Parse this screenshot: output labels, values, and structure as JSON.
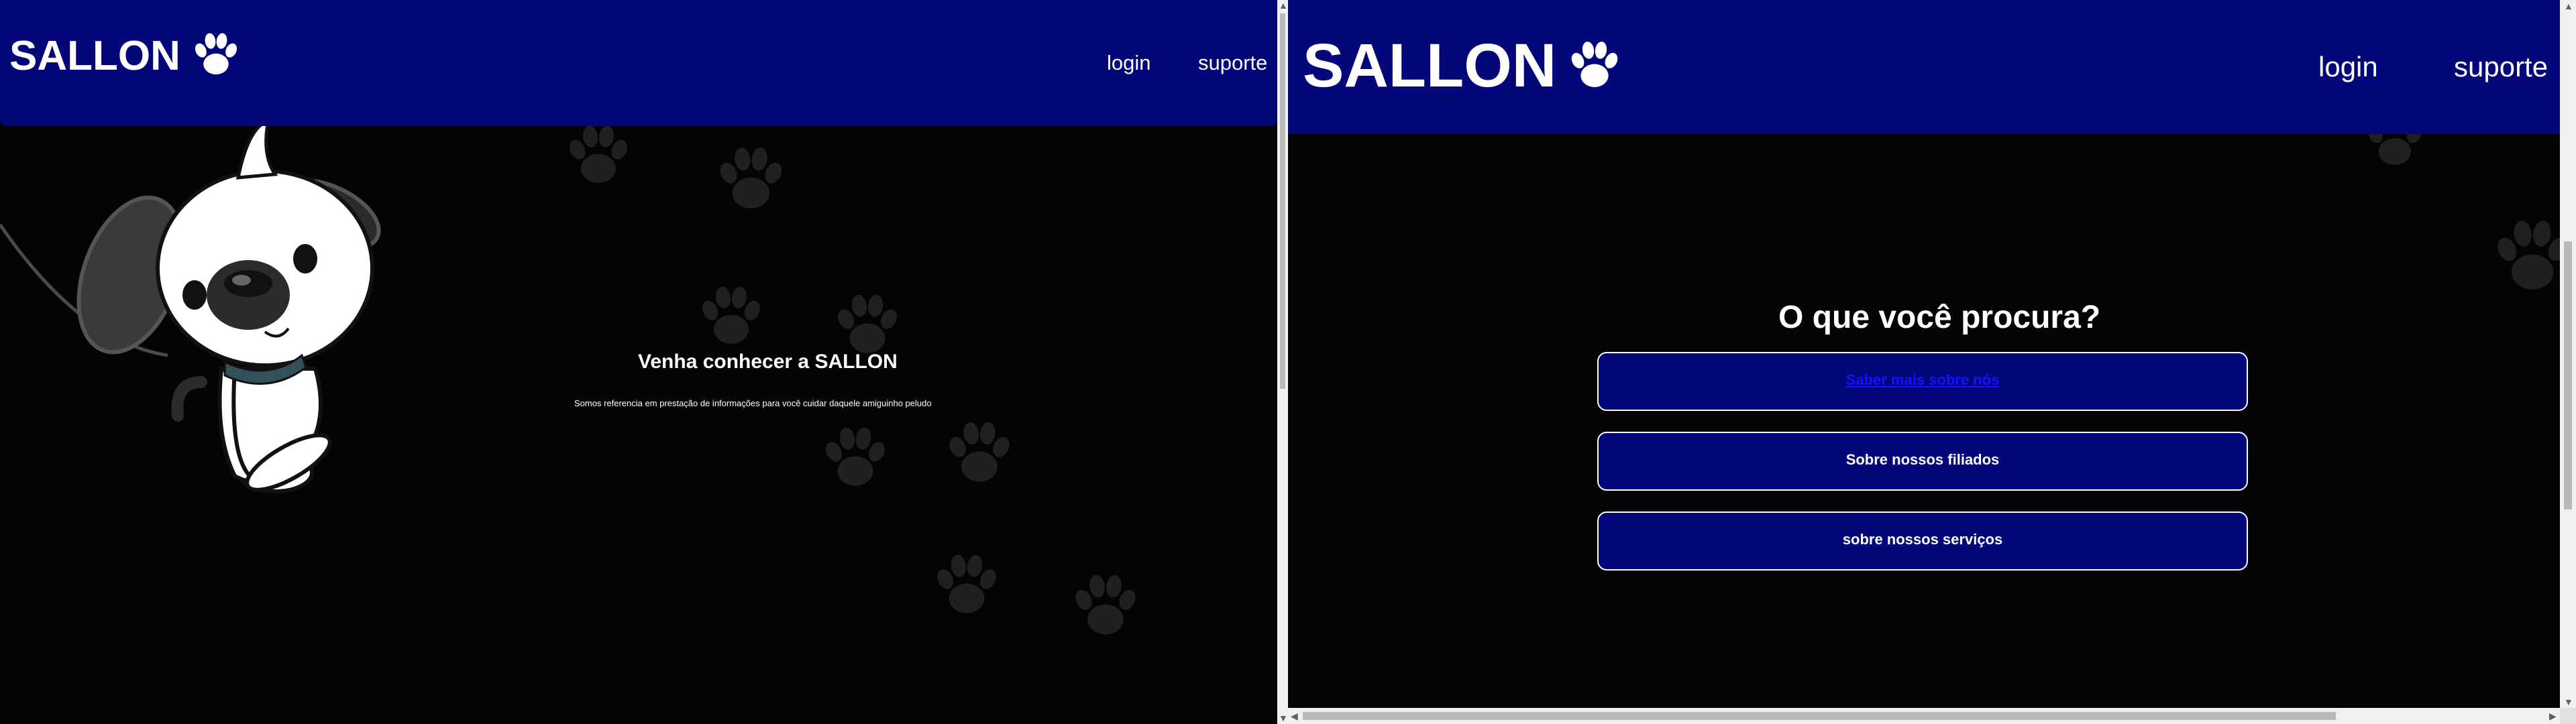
{
  "brand": "SALLON",
  "nav": {
    "login": "login",
    "support": "suporte"
  },
  "left": {
    "hero_title": "Venha conhecer a SALLON",
    "hero_subtitle": "Somos referencia em prestação de informações para você cuidar daquele amiguinho peludo"
  },
  "right": {
    "question": "O que você procura?",
    "options": [
      {
        "label": "Saber mais sobre nós"
      },
      {
        "label": "Sobre nossos filiados"
      },
      {
        "label": "sobre nossos serviços"
      }
    ]
  },
  "colors": {
    "header": "#03077a",
    "background": "#060307",
    "link": "#1313ff"
  },
  "icons": {
    "logo": "paw-icon",
    "mascot": "dog-mascot"
  }
}
